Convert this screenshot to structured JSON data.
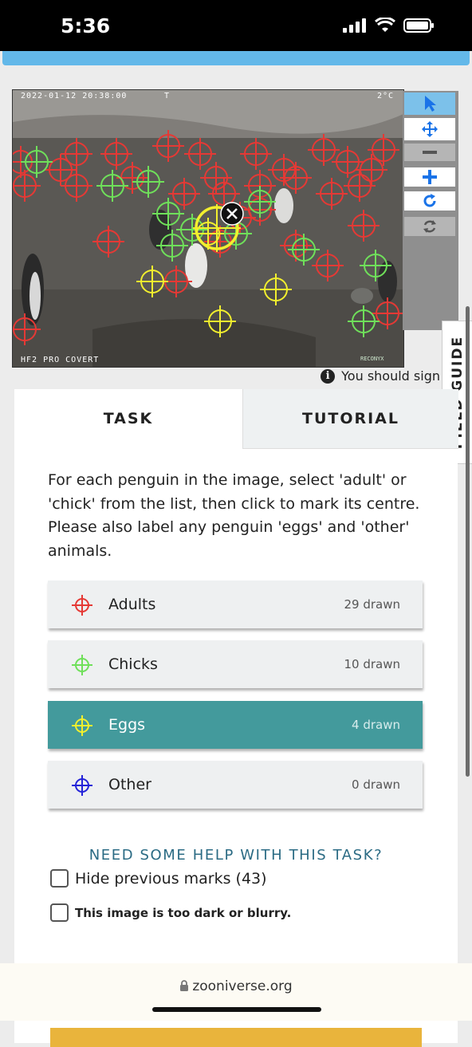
{
  "status_bar": {
    "time": "5:36"
  },
  "subject_image": {
    "timestamp": "2022-01-12 20:38:00",
    "marker_t": "T",
    "temperature": "2°C",
    "camera_model": "HF2 PRO COVERT",
    "camera_brand": "RECONYX"
  },
  "toolbar": {
    "items": [
      {
        "name": "pointer-tool",
        "icon": "cursor-arrow-icon"
      },
      {
        "name": "move-tool",
        "icon": "move-arrows-icon"
      },
      {
        "name": "zoom-out",
        "icon": "minus-icon"
      },
      {
        "name": "zoom-in",
        "icon": "plus-icon"
      },
      {
        "name": "rotate",
        "icon": "rotate-icon"
      },
      {
        "name": "reset",
        "icon": "reset-icon"
      }
    ]
  },
  "notice": {
    "text": "You should sign"
  },
  "field_guide": {
    "label": "FIELD GUIDE"
  },
  "tabs": {
    "task": "TASK",
    "tutorial": "TUTORIAL"
  },
  "task": {
    "instructions": "For each penguin in the image, select 'adult' or 'chick' from the list, then click to mark its centre. Please also label any penguin 'eggs' and 'other' animals.",
    "tools": [
      {
        "label": "Adults",
        "count": "29 drawn",
        "color": "#e53935"
      },
      {
        "label": "Chicks",
        "count": "10 drawn",
        "color": "#6fe05a"
      },
      {
        "label": "Eggs",
        "count": "4 drawn",
        "color": "#f2ef2e"
      },
      {
        "label": "Other",
        "count": "0 drawn",
        "color": "#2323d9"
      }
    ],
    "selected_tool": "Eggs",
    "help_link": "NEED SOME HELP WITH THIS TASK?",
    "hide_marks_label": "Hide previous marks (43)",
    "too_dark_label": "This image is too dark or blurry."
  },
  "browser": {
    "url": "zooniverse.org"
  },
  "colors": {
    "accent_blue": "#63b8e9",
    "selected_tool": "#439a9c",
    "done_button": "#e9b43c"
  }
}
